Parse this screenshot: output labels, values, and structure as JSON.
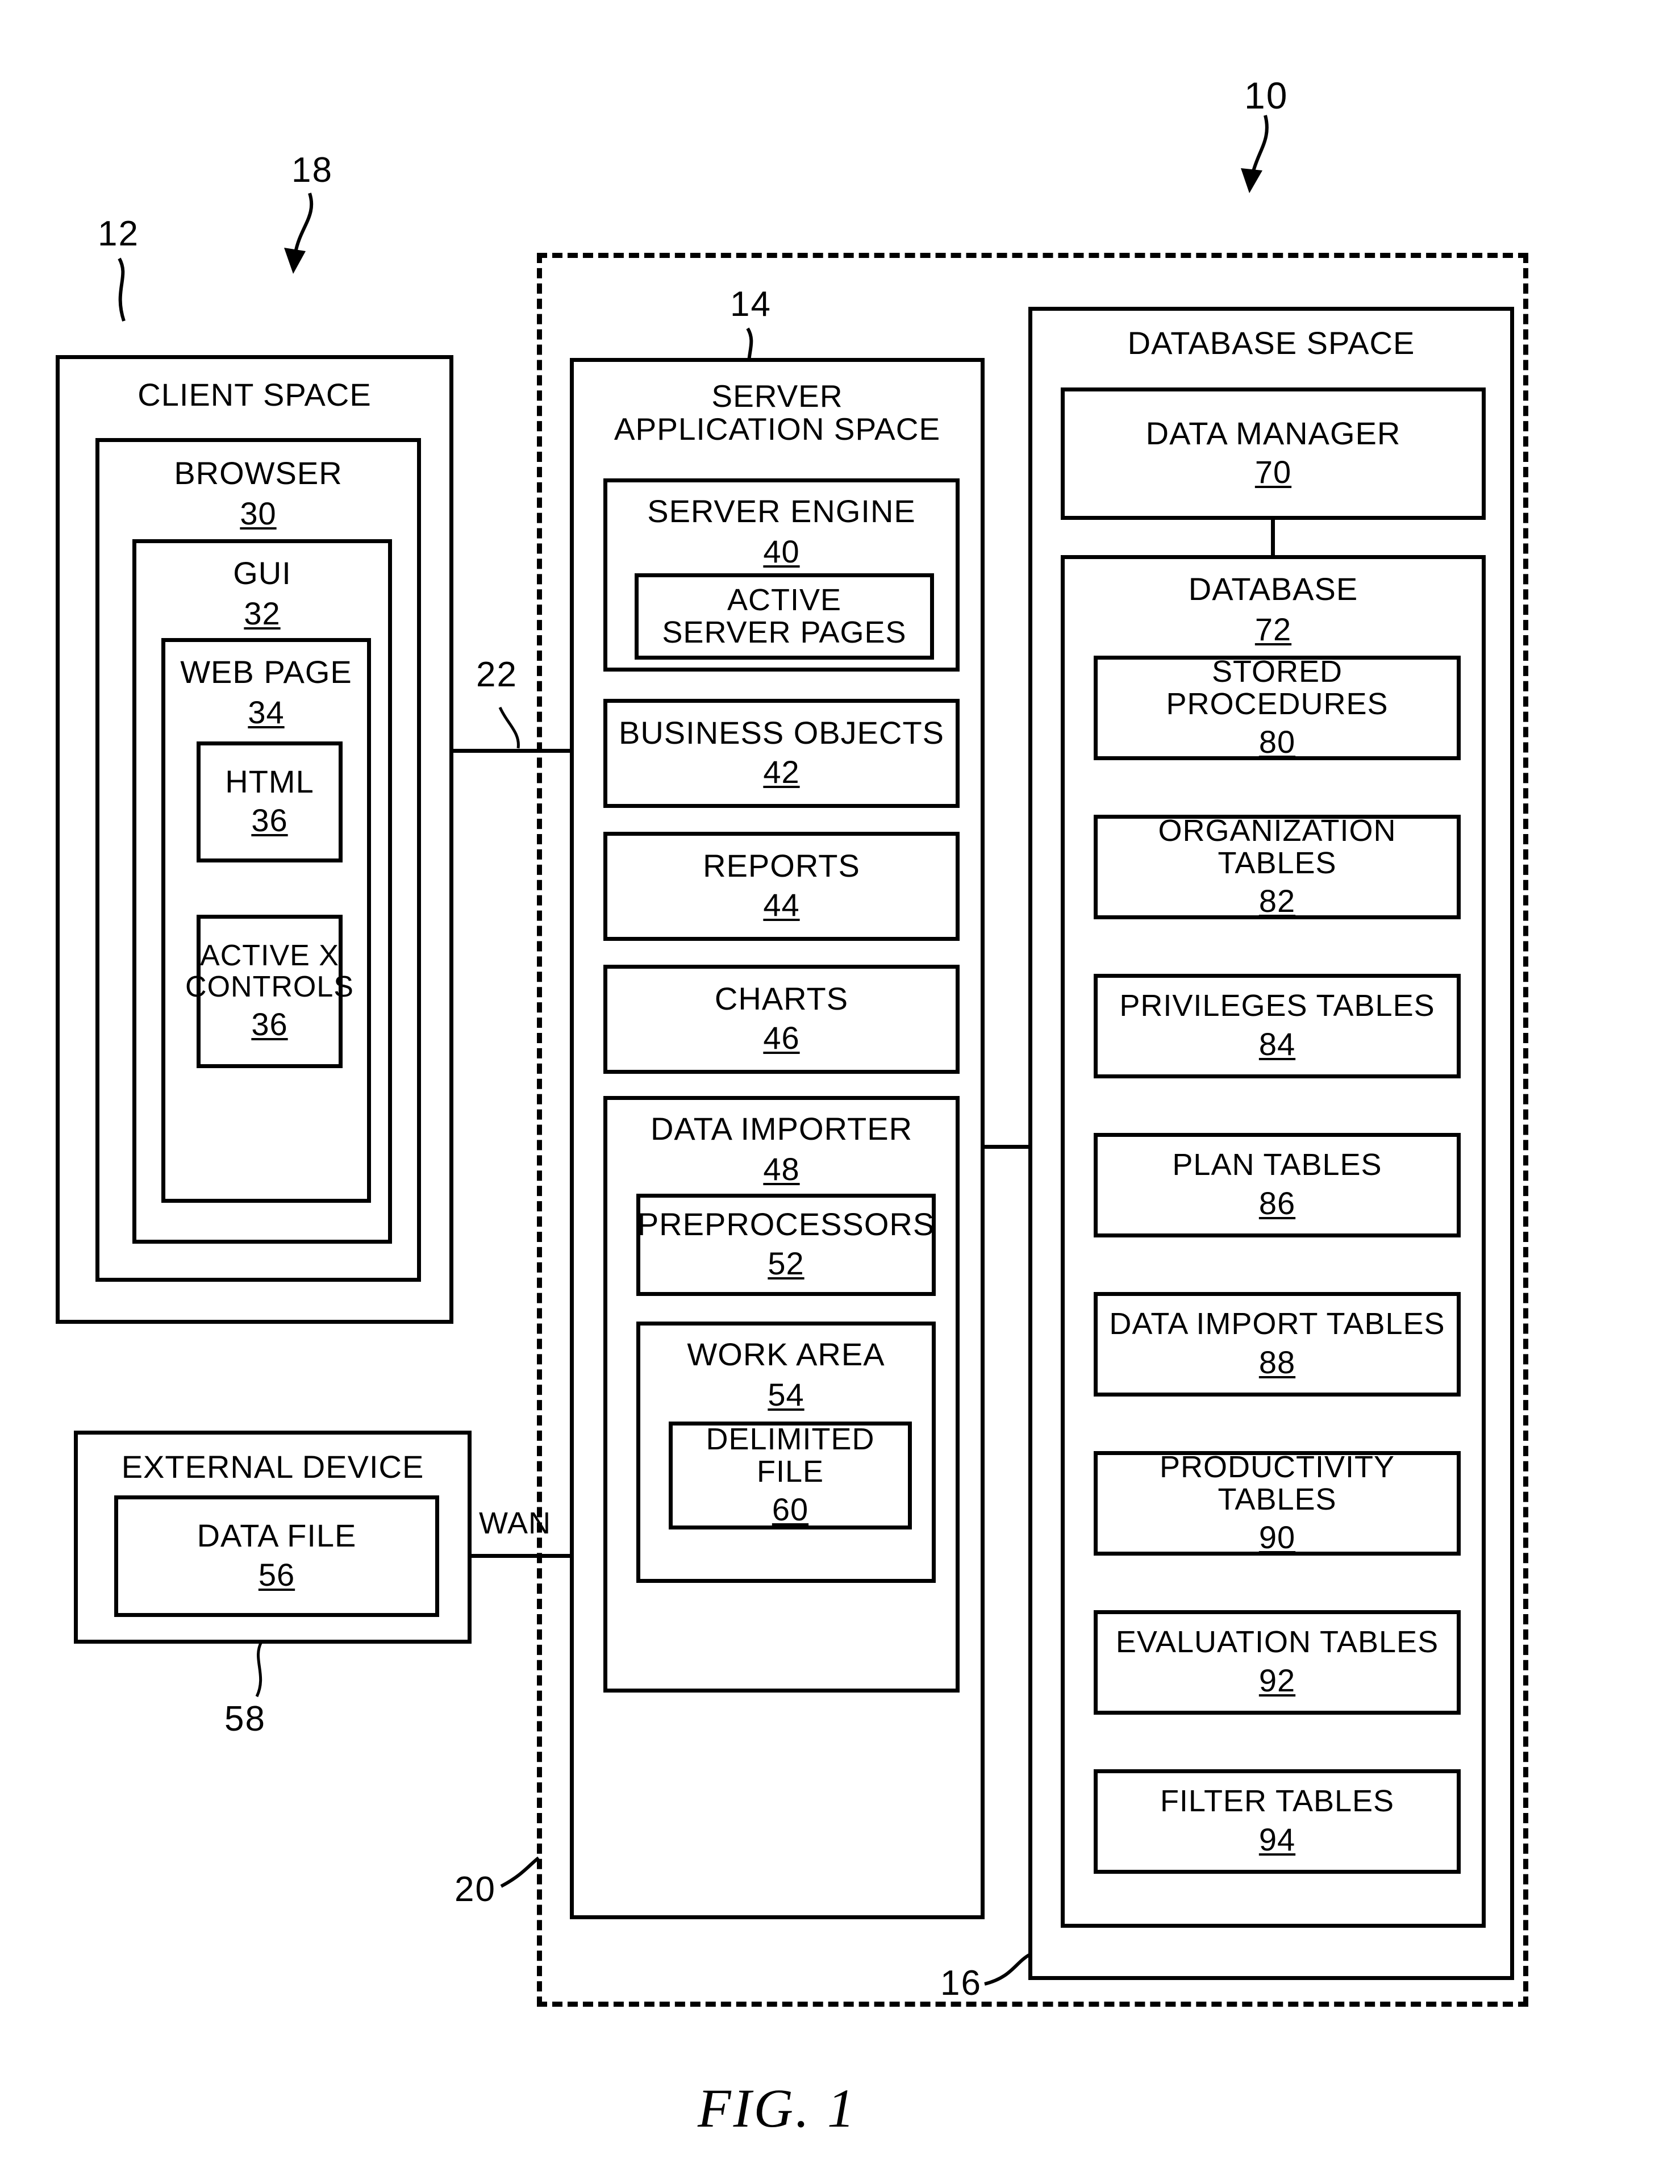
{
  "figure": {
    "caption": "FIG.  1",
    "system_ref": "10",
    "client_ref": "12",
    "server_ref": "14",
    "database_ref": "16",
    "network_arrow_ref": "18",
    "boundary_ref": "20",
    "client_link_ref": "22",
    "external_device_ref": "58",
    "wan_label": "WAN"
  },
  "client_space": {
    "title": "CLIENT SPACE",
    "browser": {
      "title": "BROWSER",
      "num": "30",
      "gui": {
        "title": "GUI",
        "num": "32",
        "web_page": {
          "title": "WEB PAGE",
          "num": "34",
          "html": {
            "title": "HTML",
            "num": "36"
          },
          "active_x": {
            "title": "ACTIVE X\nCONTROLS",
            "num": "36"
          }
        }
      }
    }
  },
  "external_device": {
    "title": "EXTERNAL DEVICE",
    "data_file": {
      "title": "DATA FILE",
      "num": "56"
    }
  },
  "server_application_space": {
    "title": "SERVER\nAPPLICATION SPACE",
    "server_engine": {
      "title": "SERVER ENGINE",
      "num": "40",
      "active_server_pages": {
        "title": "ACTIVE\nSERVER PAGES"
      }
    },
    "business_objects": {
      "title": "BUSINESS OBJECTS",
      "num": "42"
    },
    "reports": {
      "title": "REPORTS",
      "num": "44"
    },
    "charts": {
      "title": "CHARTS",
      "num": "46"
    },
    "data_importer": {
      "title": "DATA IMPORTER",
      "num": "48",
      "preprocessors": {
        "title": "PREPROCESSORS",
        "num": "52"
      },
      "work_area": {
        "title": "WORK AREA",
        "num": "54",
        "delimited_file": {
          "title": "DELIMITED FILE",
          "num": "60"
        }
      }
    }
  },
  "database_space": {
    "title": "DATABASE SPACE",
    "data_manager": {
      "title": "DATA MANAGER",
      "num": "70"
    },
    "database": {
      "title": "DATABASE",
      "num": "72",
      "tables": [
        {
          "title": "STORED PROCEDURES",
          "num": "80"
        },
        {
          "title": "ORGANIZATION TABLES",
          "num": "82"
        },
        {
          "title": "PRIVILEGES TABLES",
          "num": "84"
        },
        {
          "title": "PLAN TABLES",
          "num": "86"
        },
        {
          "title": "DATA IMPORT TABLES",
          "num": "88"
        },
        {
          "title": "PRODUCTIVITY TABLES",
          "num": "90"
        },
        {
          "title": "EVALUATION TABLES",
          "num": "92"
        },
        {
          "title": "FILTER TABLES",
          "num": "94"
        }
      ]
    }
  }
}
